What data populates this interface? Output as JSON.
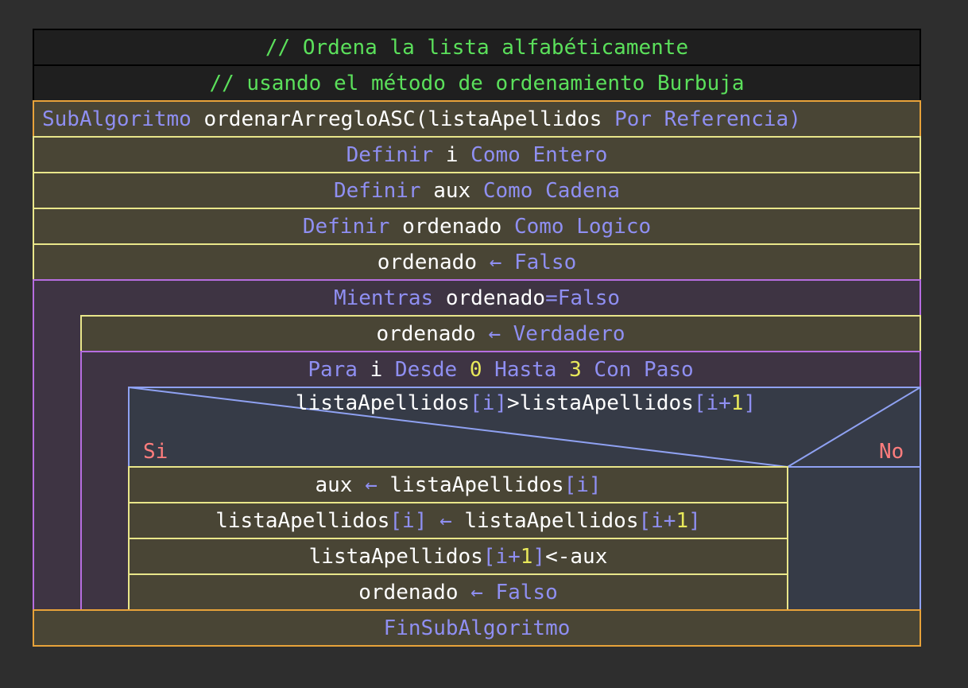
{
  "comments": [
    "// Ordena la lista alfabéticamente",
    "// usando el método de ordenamiento Burbuja"
  ],
  "header": {
    "kw1": "SubAlgoritmo",
    "name": "ordenarArregloASC(listaApellidos",
    "kw2": "Por Referencia)"
  },
  "defs": [
    {
      "kw1": "Definir",
      "var": "i",
      "kw2": "Como Entero"
    },
    {
      "kw1": "Definir",
      "var": "aux",
      "kw2": "Como Cadena"
    },
    {
      "kw1": "Definir",
      "var": "ordenado",
      "kw2": "Como Logico"
    }
  ],
  "assign_false_1": {
    "var": "ordenado",
    "arrow": "←",
    "val": "Falso"
  },
  "while": {
    "kw": "Mientras",
    "var": "ordenado",
    "op": "=",
    "val": "Falso"
  },
  "assign_true": {
    "var": "ordenado",
    "arrow": "←",
    "val": "Verdadero"
  },
  "for": {
    "kw1": "Para",
    "var": "i",
    "kw2": "Desde",
    "from": "0",
    "kw3": "Hasta",
    "to": "3",
    "kw4": "Con Paso"
  },
  "if": {
    "a1": "listaApellidos",
    "b1": "[",
    "i1": "i",
    "b2": "]",
    "op": ">",
    "a2": "listaApellidos",
    "b3": "[",
    "i2": "i",
    "plus": "+",
    "one": "1",
    "b4": "]",
    "yes": "Si",
    "no": "No"
  },
  "stmt1": {
    "var": "aux",
    "arrow": "←",
    "arr": "listaApellidos",
    "b1": "[",
    "i": "i",
    "b2": "]"
  },
  "stmt2": {
    "arr1": "listaApellidos",
    "b1": "[",
    "i1": "i",
    "b2": "]",
    "arrow": "←",
    "arr2": "listaApellidos",
    "b3": "[",
    "i2": "i",
    "plus": "+",
    "one": "1",
    "b4": "]"
  },
  "stmt3": {
    "arr": "listaApellidos",
    "b1": "[",
    "i": "i",
    "plus": "+",
    "one": "1",
    "b2": "]",
    "op": "<-",
    "var": "aux"
  },
  "stmt4": {
    "var": "ordenado",
    "arrow": "←",
    "val": "Falso"
  },
  "footer": "FinSubAlgoritmo"
}
